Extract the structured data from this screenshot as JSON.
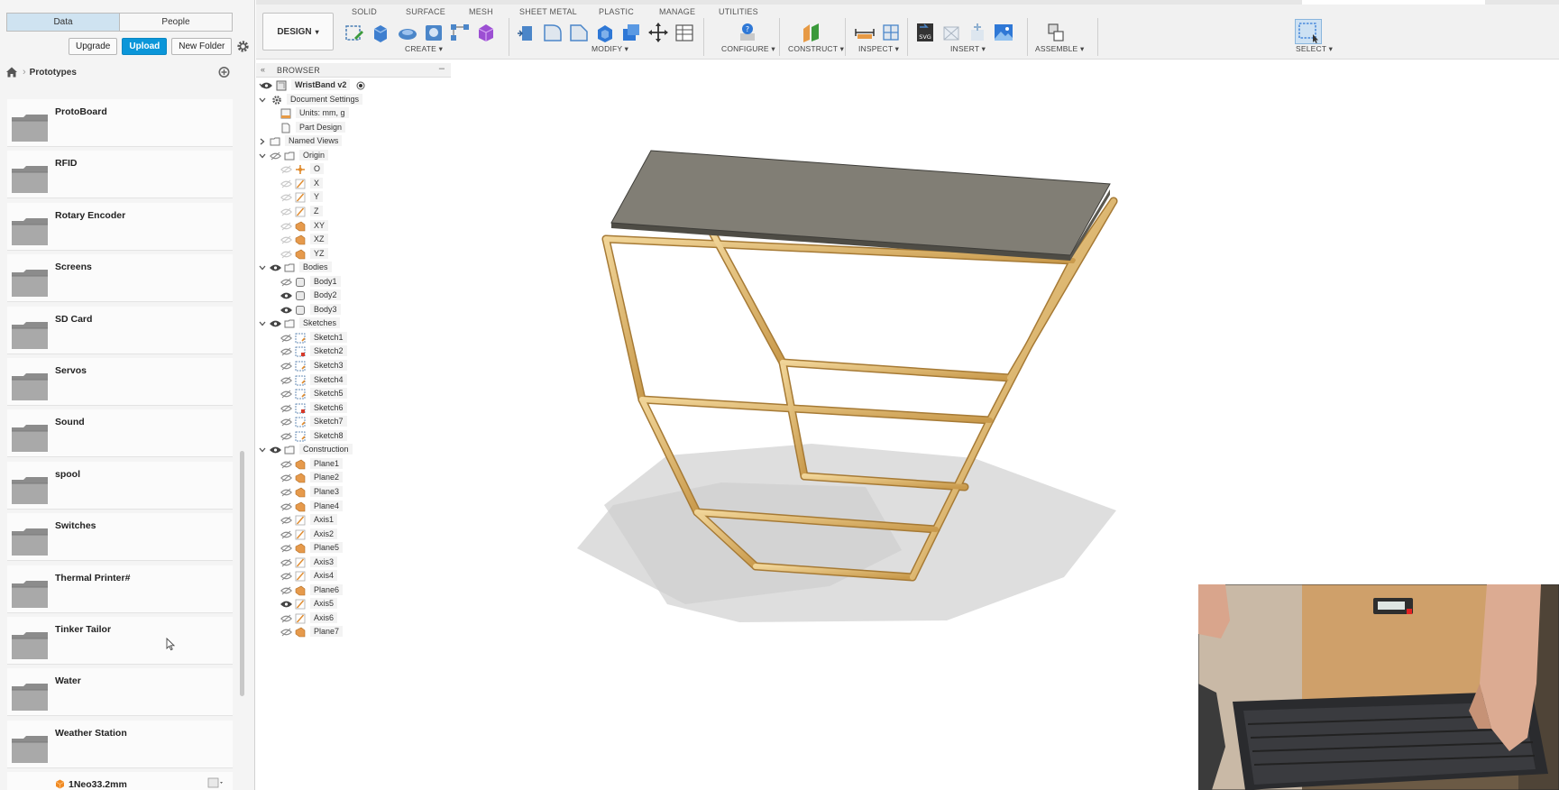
{
  "data_panel": {
    "tabs": [
      {
        "label": "Data",
        "active": true
      },
      {
        "label": "People",
        "active": false
      }
    ],
    "actions": {
      "upgrade": "Upgrade",
      "upload": "Upload",
      "new_folder": "New Folder"
    },
    "breadcrumb": {
      "current": "Prototypes"
    },
    "items": [
      {
        "name": "ProtoBoard",
        "type": "folder"
      },
      {
        "name": "RFID",
        "type": "folder"
      },
      {
        "name": "Rotary Encoder",
        "type": "folder"
      },
      {
        "name": "Screens",
        "type": "folder"
      },
      {
        "name": "SD Card",
        "type": "folder"
      },
      {
        "name": "Servos",
        "type": "folder"
      },
      {
        "name": "Sound",
        "type": "folder"
      },
      {
        "name": "spool",
        "type": "folder"
      },
      {
        "name": "Switches",
        "type": "folder"
      },
      {
        "name": "Thermal Printer#",
        "type": "folder"
      },
      {
        "name": "Tinker Tailor",
        "type": "folder"
      },
      {
        "name": "Water",
        "type": "folder"
      },
      {
        "name": "Weather Station",
        "type": "folder"
      },
      {
        "name": "1Neo33.2mm",
        "type": "design"
      }
    ]
  },
  "toolbar": {
    "workspace": "DESIGN",
    "tabs": [
      "SOLID",
      "SURFACE",
      "MESH",
      "SHEET METAL",
      "PLASTIC",
      "MANAGE",
      "UTILITIES"
    ],
    "groups": [
      "CREATE",
      "MODIFY",
      "CONFIGURE",
      "CONSTRUCT",
      "INSPECT",
      "INSERT",
      "ASSEMBLE",
      "SELECT"
    ]
  },
  "browser": {
    "title": "BROWSER",
    "root": "WristBand v2",
    "document_settings": "Document Settings",
    "units": "Units: mm, g",
    "part_design": "Part Design",
    "named_views": "Named Views",
    "origin": "Origin",
    "origin_items": [
      "O",
      "X",
      "Y",
      "Z",
      "XY",
      "XZ",
      "YZ"
    ],
    "bodies": "Bodies",
    "body_items": [
      "Body1",
      "Body2",
      "Body3"
    ],
    "sketches": "Sketches",
    "sketch_items": [
      "Sketch1",
      "Sketch2",
      "Sketch3",
      "Sketch4",
      "Sketch5",
      "Sketch6",
      "Sketch7",
      "Sketch8"
    ],
    "construction": "Construction",
    "construction_items": [
      "Plane1",
      "Plane2",
      "Plane3",
      "Plane4",
      "Axis1",
      "Axis2",
      "Plane5",
      "Axis3",
      "Axis4",
      "Plane6",
      "Axis5",
      "Axis6",
      "Plane7"
    ]
  },
  "colors": {
    "accent": "#0b96d9",
    "tube": "#d9b16a",
    "plate": "#7f7d74"
  }
}
